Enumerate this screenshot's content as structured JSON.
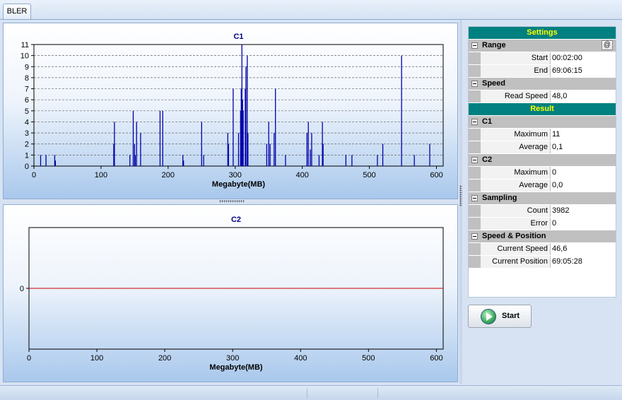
{
  "tab": {
    "label": "BLER"
  },
  "chart_data": [
    {
      "type": "bar",
      "title": "C1",
      "xlabel": "Megabyte(MB)",
      "ylabel": "",
      "xlim": [
        0,
        610
      ],
      "ylim": [
        0,
        11
      ],
      "xticks": [
        0,
        100,
        200,
        300,
        400,
        500,
        600
      ],
      "yticks": [
        0,
        1,
        2,
        3,
        4,
        5,
        6,
        7,
        8,
        9,
        10,
        11
      ],
      "grid": true,
      "color": "#0000aa",
      "points": [
        {
          "x": 10,
          "y": 1
        },
        {
          "x": 18,
          "y": 1
        },
        {
          "x": 31,
          "y": 1
        },
        {
          "x": 32,
          "y": 0.5
        },
        {
          "x": 119,
          "y": 2
        },
        {
          "x": 120,
          "y": 4
        },
        {
          "x": 143,
          "y": 1
        },
        {
          "x": 148,
          "y": 5
        },
        {
          "x": 150,
          "y": 2
        },
        {
          "x": 151,
          "y": 1
        },
        {
          "x": 153,
          "y": 4
        },
        {
          "x": 159,
          "y": 3
        },
        {
          "x": 188,
          "y": 5
        },
        {
          "x": 192,
          "y": 5
        },
        {
          "x": 222,
          "y": 1
        },
        {
          "x": 223,
          "y": 0.5
        },
        {
          "x": 250,
          "y": 4
        },
        {
          "x": 253,
          "y": 1
        },
        {
          "x": 289,
          "y": 3
        },
        {
          "x": 290,
          "y": 2
        },
        {
          "x": 297,
          "y": 7
        },
        {
          "x": 305,
          "y": 3
        },
        {
          "x": 308,
          "y": 5
        },
        {
          "x": 309,
          "y": 7
        },
        {
          "x": 310,
          "y": 11
        },
        {
          "x": 311,
          "y": 6
        },
        {
          "x": 312,
          "y": 5
        },
        {
          "x": 315,
          "y": 7
        },
        {
          "x": 316,
          "y": 9
        },
        {
          "x": 318,
          "y": 10
        },
        {
          "x": 319,
          "y": 3
        },
        {
          "x": 347,
          "y": 2
        },
        {
          "x": 350,
          "y": 4
        },
        {
          "x": 352,
          "y": 2
        },
        {
          "x": 358,
          "y": 3
        },
        {
          "x": 360,
          "y": 7
        },
        {
          "x": 375,
          "y": 1
        },
        {
          "x": 407,
          "y": 3
        },
        {
          "x": 409,
          "y": 4
        },
        {
          "x": 412,
          "y": 1.5
        },
        {
          "x": 414,
          "y": 3
        },
        {
          "x": 425,
          "y": 1
        },
        {
          "x": 430,
          "y": 4
        },
        {
          "x": 431,
          "y": 2
        },
        {
          "x": 465,
          "y": 1
        },
        {
          "x": 474,
          "y": 1
        },
        {
          "x": 512,
          "y": 1
        },
        {
          "x": 520,
          "y": 2
        },
        {
          "x": 548,
          "y": 10
        },
        {
          "x": 567,
          "y": 1
        },
        {
          "x": 590,
          "y": 2
        }
      ]
    },
    {
      "type": "line",
      "title": "C2",
      "xlabel": "Megabyte(MB)",
      "ylabel": "",
      "xlim": [
        0,
        610
      ],
      "xticks": [
        0,
        100,
        200,
        300,
        400,
        500,
        600
      ],
      "yticks": [
        0
      ],
      "grid": false,
      "color": "#cc0000",
      "series": [
        {
          "x": [
            0,
            610
          ],
          "values": [
            0,
            0
          ]
        }
      ]
    }
  ],
  "panel": {
    "settings_header": "Settings",
    "range": {
      "label": "Range",
      "button": "@",
      "start_label": "Start",
      "start_value": "00:02:00",
      "end_label": "End",
      "end_value": "69:06:15"
    },
    "speed": {
      "label": "Speed",
      "read_speed_label": "Read Speed",
      "read_speed_value": "48,0"
    },
    "result_header": "Result",
    "c1": {
      "label": "C1",
      "maximum_label": "Maximum",
      "maximum_value": "11",
      "average_label": "Average",
      "average_value": "0,1"
    },
    "c2": {
      "label": "C2",
      "maximum_label": "Maximum",
      "maximum_value": "0",
      "average_label": "Average",
      "average_value": "0,0"
    },
    "sampling": {
      "label": "Sampling",
      "count_label": "Count",
      "count_value": "3982",
      "error_label": "Error",
      "error_value": "0"
    },
    "speed_position": {
      "label": "Speed & Position",
      "current_speed_label": "Current Speed",
      "current_speed_value": "46,6",
      "current_position_label": "Current Position",
      "current_position_value": "69:05:28"
    }
  },
  "start_button": {
    "label": "Start"
  }
}
